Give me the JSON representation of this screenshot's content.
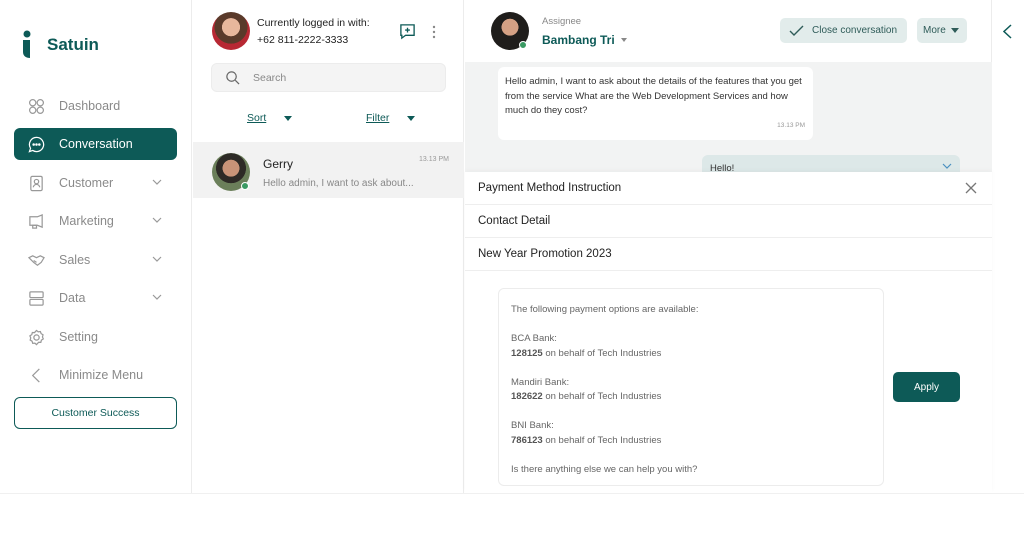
{
  "brand": {
    "name": "Satuin",
    "color": "#0d5a57"
  },
  "sidebar": {
    "items": [
      {
        "label": "Dashboard",
        "icon": "grid-icon",
        "active": false,
        "expandable": false
      },
      {
        "label": "Conversation",
        "icon": "chat-bubble-icon",
        "active": true,
        "expandable": false
      },
      {
        "label": "Customer",
        "icon": "contact-book-icon",
        "active": false,
        "expandable": true
      },
      {
        "label": "Marketing",
        "icon": "megaphone-icon",
        "active": false,
        "expandable": true
      },
      {
        "label": "Sales",
        "icon": "handshake-icon",
        "active": false,
        "expandable": true
      },
      {
        "label": "Data",
        "icon": "server-icon",
        "active": false,
        "expandable": true
      },
      {
        "label": "Setting",
        "icon": "gear-icon",
        "active": false,
        "expandable": false
      },
      {
        "label": "Minimize Menu",
        "icon": "chevron-left-icon",
        "active": false,
        "expandable": false
      }
    ],
    "footer_button": "Customer Success"
  },
  "account": {
    "label": "Currently logged in with:",
    "phone": "+62 811-2222-3333"
  },
  "search": {
    "placeholder": "Search"
  },
  "list_controls": {
    "sort": "Sort",
    "filter": "Filter"
  },
  "conversations": [
    {
      "name": "Gerry",
      "preview": "Hello admin, I want to ask about...",
      "time": "13.13 PM",
      "online": true
    }
  ],
  "chat": {
    "assignee_label": "Assignee",
    "assignee": "Bambang Tri",
    "close_label": "Close conversation",
    "more_label": "More",
    "messages": [
      {
        "text": "Hello admin, I want to ask about the details of the features that you get from the service What are the Web Development Services and how much do they cost?",
        "time": "13.13 PM",
        "direction": "in"
      },
      {
        "text": "Hello!",
        "direction": "out"
      }
    ]
  },
  "templates": {
    "items": [
      "Payment Method Instruction",
      "Contact Detail",
      "New Year Promotion 2023"
    ],
    "preview": {
      "intro": "The following payment options are available:",
      "banks": [
        {
          "name": "BCA Bank:",
          "account": "128125",
          "suffix": " on behalf of Tech Industries"
        },
        {
          "name": "Mandiri Bank:",
          "account": "182622",
          "suffix": " on behalf of Tech Industries"
        },
        {
          "name": "BNI Bank:",
          "account": "786123",
          "suffix": " on behalf of Tech Industries"
        }
      ],
      "outro": "Is there anything else we can help you with?"
    },
    "apply_label": "Apply"
  }
}
